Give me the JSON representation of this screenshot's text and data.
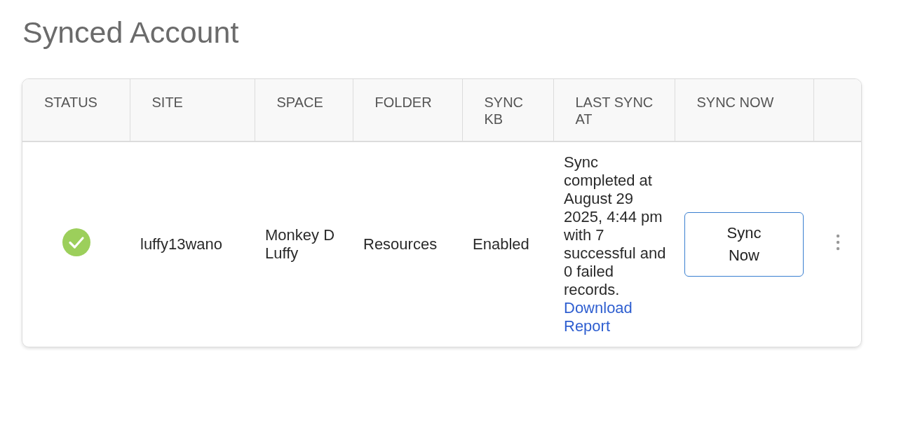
{
  "title": "Synced Account",
  "table": {
    "columns": [
      "STATUS",
      "SITE",
      "SPACE",
      "FOLDER",
      "SYNC KB",
      "LAST SYNC AT",
      "SYNC NOW"
    ],
    "rows": [
      {
        "synced": true,
        "site": "luffy13wano",
        "space": "Monkey D Luffy",
        "folder": "Resources",
        "sync_kb": "Enabled",
        "last_sync": "Sync completed at August 29 2025, 4:44 pm with 7 successful and 0 failed records.",
        "report_link": "Download Report",
        "sync_button": "Sync Now"
      }
    ]
  }
}
